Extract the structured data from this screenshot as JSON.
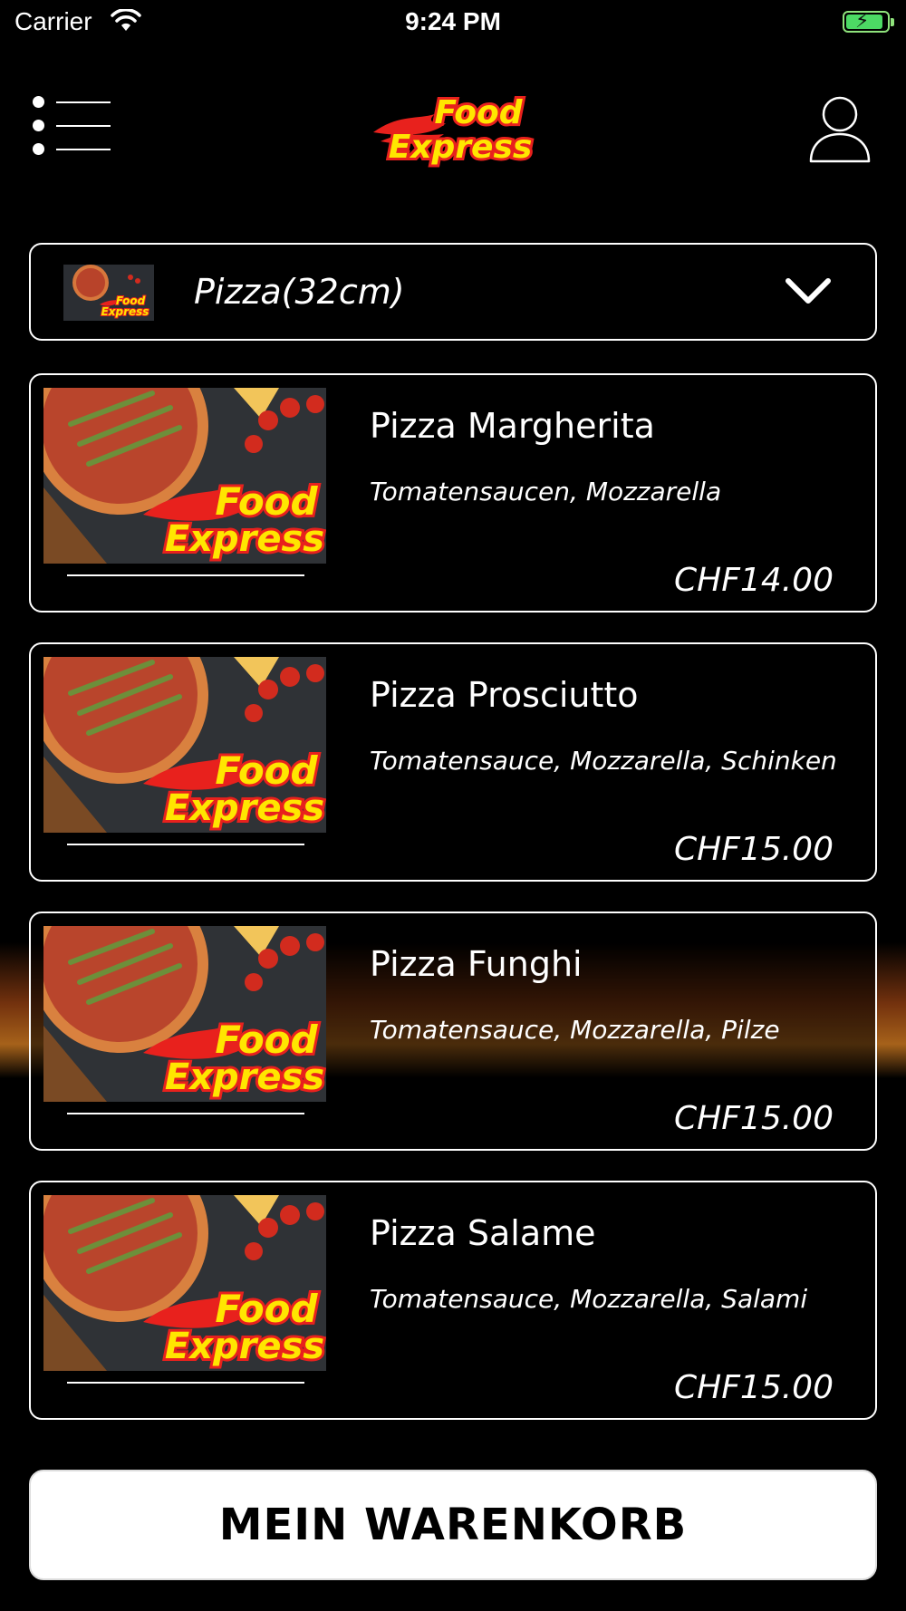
{
  "status_bar": {
    "carrier": "Carrier",
    "time": "9:24 PM",
    "wifi_icon": "wifi-icon",
    "battery_icon": "battery-charging-icon",
    "battery_color": "#4cd964"
  },
  "header": {
    "menu_icon": "menu-list-icon",
    "logo_text_line1": "Food",
    "logo_text_line2": "Express",
    "user_icon": "user-icon"
  },
  "category": {
    "selected": "Pizza(32cm)",
    "chevron_icon": "chevron-down-icon"
  },
  "products": [
    {
      "title": "Pizza Margherita",
      "description": "Tomatensaucen, Mozzarella",
      "price": "CHF14.00"
    },
    {
      "title": "Pizza Prosciutto",
      "description": "Tomatensauce, Mozzarella, Schinken",
      "price": "CHF15.00"
    },
    {
      "title": "Pizza Funghi",
      "description": "Tomatensauce, Mozzarella, Pilze",
      "price": "CHF15.00"
    },
    {
      "title": "Pizza Salame",
      "description": "Tomatensauce, Mozzarella, Salami",
      "price": "CHF15.00"
    }
  ],
  "cart": {
    "label": "MEIN WARENKORB"
  },
  "colors": {
    "background": "#000000",
    "logo_red": "#e8211d",
    "logo_yellow": "#ffe600",
    "card_border": "#ffffff"
  }
}
